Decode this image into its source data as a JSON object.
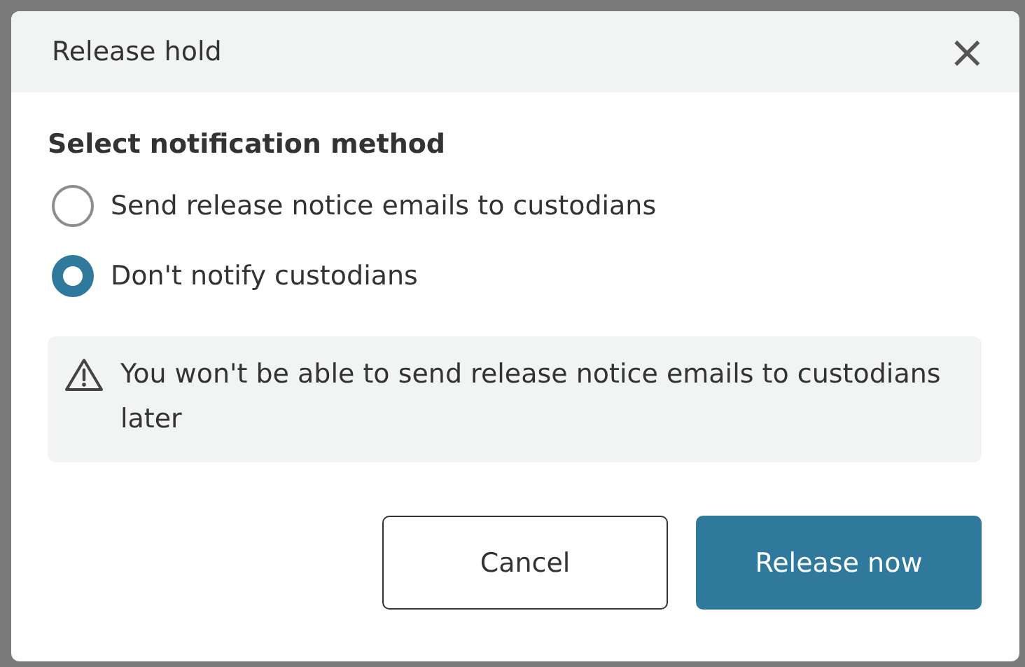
{
  "dialog": {
    "title": "Release hold",
    "close": "×"
  },
  "section_title": "Select notification method",
  "options": [
    {
      "label": "Send release notice emails to custodians",
      "selected": false
    },
    {
      "label": "Don't notify custodians",
      "selected": true
    }
  ],
  "warning": "You won't be able to send release notice emails to custodians later",
  "buttons": [
    {
      "label": "Cancel",
      "kind": "secondary"
    },
    {
      "label": "Release now",
      "kind": "primary"
    }
  ]
}
